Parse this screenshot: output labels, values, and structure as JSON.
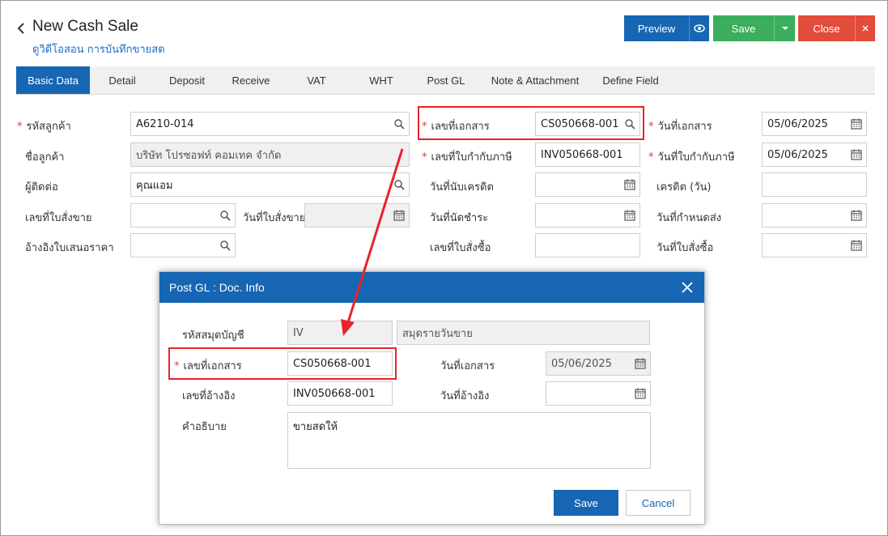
{
  "header": {
    "title": "New Cash Sale",
    "video_link": "ดูวิดีโอสอน การบันทึกขายสด",
    "preview_label": "Preview",
    "save_label": "Save",
    "close_label": "Close"
  },
  "tabs": [
    "Basic Data",
    "Detail",
    "Deposit",
    "Receive",
    "VAT",
    "WHT",
    "Post GL",
    "Note & Attachment",
    "Define Field"
  ],
  "form": {
    "customer_code": {
      "label": "รหัสลูกค้า",
      "value": "A6210-014"
    },
    "customer_name": {
      "label": "ชื่อลูกค้า",
      "value": "บริษัท โปรซอฟท์ คอมเทค จำกัด"
    },
    "contact": {
      "label": "ผู้ติดต่อ",
      "value": "คุณแอม"
    },
    "sales_order_no": {
      "label": "เลขที่ใบสั่งขาย",
      "value": ""
    },
    "sales_order_date": {
      "label": "วันที่ใบสั่งขาย",
      "value": ""
    },
    "quotation_ref": {
      "label": "อ้างอิงใบเสนอราคา",
      "value": ""
    },
    "doc_no": {
      "label": "เลขที่เอกสาร",
      "value": "CS050668-001"
    },
    "tax_invoice_no": {
      "label": "เลขที่ใบกำกับภาษี",
      "value": "INV050668-001"
    },
    "credit_start_date": {
      "label": "วันที่นับเครดิต",
      "value": ""
    },
    "payment_due_date": {
      "label": "วันที่นัดชำระ",
      "value": ""
    },
    "po_no": {
      "label": "เลขที่ใบสั่งซื้อ",
      "value": ""
    },
    "doc_date": {
      "label": "วันที่เอกสาร",
      "value": "05/06/2025"
    },
    "tax_invoice_date": {
      "label": "วันที่ใบกำกับภาษี",
      "value": "05/06/2025"
    },
    "credit_days": {
      "label": "เครดิต (วัน)",
      "value": ""
    },
    "delivery_date": {
      "label": "วันที่กำหนดส่ง",
      "value": ""
    },
    "po_date": {
      "label": "วันที่ใบสั่งซื้อ",
      "value": ""
    }
  },
  "dialog": {
    "title": "Post GL : Doc. Info",
    "journal_code": {
      "label": "รหัสสมุดบัญชี",
      "value": "IV",
      "name": "สมุดรายวันขาย"
    },
    "doc_no": {
      "label": "เลขที่เอกสาร",
      "value": "CS050668-001"
    },
    "doc_date": {
      "label": "วันที่เอกสาร",
      "value": "05/06/2025"
    },
    "ref_no": {
      "label": "เลขที่อ้างอิง",
      "value": "INV050668-001"
    },
    "ref_date": {
      "label": "วันที่อ้างอิง",
      "value": ""
    },
    "description": {
      "label": "คำอธิบาย",
      "value": "ขายสดให้"
    },
    "save_label": "Save",
    "cancel_label": "Cancel"
  },
  "colors": {
    "primary": "#1666b3",
    "success": "#3aae5c",
    "danger": "#e24c3b",
    "highlight": "#e8232b"
  },
  "icons": [
    "chevron-left-icon",
    "eye-icon",
    "caret-down-icon",
    "close-icon",
    "search-icon",
    "calendar-icon"
  ]
}
